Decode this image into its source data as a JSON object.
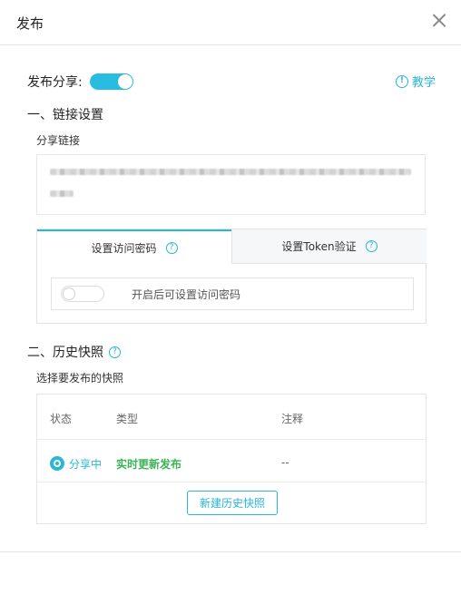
{
  "dialog": {
    "title": "发布"
  },
  "share": {
    "label": "发布分享:",
    "enabled": true
  },
  "help": {
    "icon": "exclamation-circle-icon",
    "label": "教学",
    "icon_glyph": "!"
  },
  "section1": {
    "title": "一、链接设置",
    "link_label": "分享链接"
  },
  "tabs": [
    {
      "label": "设置访问密码",
      "active": true
    },
    {
      "label": "设置Token验证",
      "active": false
    }
  ],
  "help_glyph": "?",
  "password": {
    "enabled": false,
    "hint": "开启后可设置访问密码"
  },
  "section2": {
    "title": "二、历史快照",
    "select_label": "选择要发布的快照"
  },
  "table": {
    "headers": {
      "status": "状态",
      "type": "类型",
      "note": "注释"
    },
    "rows": [
      {
        "status": "分享中",
        "type": "实时更新发布",
        "note": "--"
      }
    ]
  },
  "actions": {
    "new_snapshot": "新建历史快照"
  },
  "colors": {
    "accent": "#28b7d8",
    "type_green": "#3bb454"
  }
}
